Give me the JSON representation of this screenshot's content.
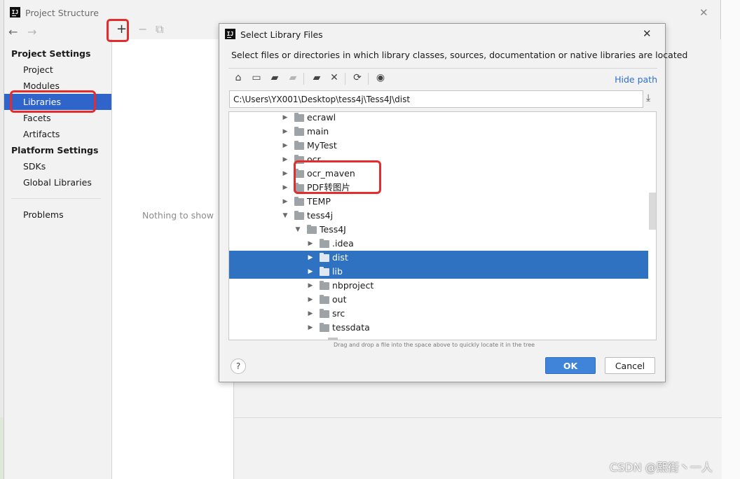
{
  "background_window": {
    "title": "Project Structure",
    "nav": {
      "back_icon": "arrow-left-icon",
      "forward_icon": "arrow-right-icon"
    },
    "sidebar": {
      "project_settings_heading": "Project Settings",
      "project_items": [
        {
          "label": "Project",
          "selected": false
        },
        {
          "label": "Modules",
          "selected": false
        },
        {
          "label": "Libraries",
          "selected": true
        },
        {
          "label": "Facets",
          "selected": false
        },
        {
          "label": "Artifacts",
          "selected": false
        }
      ],
      "platform_settings_heading": "Platform Settings",
      "platform_items": [
        {
          "label": "SDKs"
        },
        {
          "label": "Global Libraries"
        }
      ],
      "problems_label": "Problems"
    },
    "libraries_toolbar": {
      "add": "+",
      "remove": "−",
      "copy_icon": "copy-icon"
    },
    "empty_text": "Nothing to show"
  },
  "dialog": {
    "title": "Select Library Files",
    "description": "Select files or directories in which library classes, sources, documentation or native libraries are located",
    "toolbar_icons": [
      "home-icon",
      "desktop-icon",
      "project-folder-icon",
      "module-folder-icon",
      "new-folder-icon",
      "delete-icon",
      "refresh-icon",
      "show-hidden-icon"
    ],
    "hide_path_label": "Hide path",
    "path_value": "C:\\Users\\YX001\\Desktop\\tess4j\\Tess4J\\dist",
    "tree": [
      {
        "label": "ecrawl",
        "expanded": false,
        "selected": false
      },
      {
        "label": "main",
        "expanded": false,
        "selected": false
      },
      {
        "label": "MyTest",
        "expanded": false,
        "selected": false
      },
      {
        "label": "ocr",
        "expanded": false,
        "selected": false
      },
      {
        "label": "ocr_maven",
        "expanded": false,
        "selected": false
      },
      {
        "label": "PDF转图片",
        "expanded": false,
        "selected": false
      },
      {
        "label": "TEMP",
        "expanded": false,
        "selected": false
      },
      {
        "label": "tess4j",
        "expanded": true,
        "selected": false
      },
      {
        "label": "Tess4J",
        "expanded": true,
        "selected": false
      },
      {
        "label": ".idea",
        "expanded": false,
        "selected": false
      },
      {
        "label": "dist",
        "expanded": false,
        "selected": true
      },
      {
        "label": "lib",
        "expanded": false,
        "selected": true
      },
      {
        "label": "nbproject",
        "expanded": false,
        "selected": false
      },
      {
        "label": "out",
        "expanded": false,
        "selected": false
      },
      {
        "label": "src",
        "expanded": false,
        "selected": false
      },
      {
        "label": "tessdata",
        "expanded": false,
        "selected": false
      }
    ],
    "drag_hint": "Drag and drop a file into the space above to quickly locate it in the tree",
    "help_label": "?",
    "ok_label": "OK",
    "cancel_label": "Cancel"
  },
  "watermark": "CSDN @熙街丶一人",
  "colors": {
    "selection": "#2f72c2",
    "sidebar_selection": "#2f65ca",
    "annotation": "#e52b2b",
    "link": "#2f6fcf"
  }
}
